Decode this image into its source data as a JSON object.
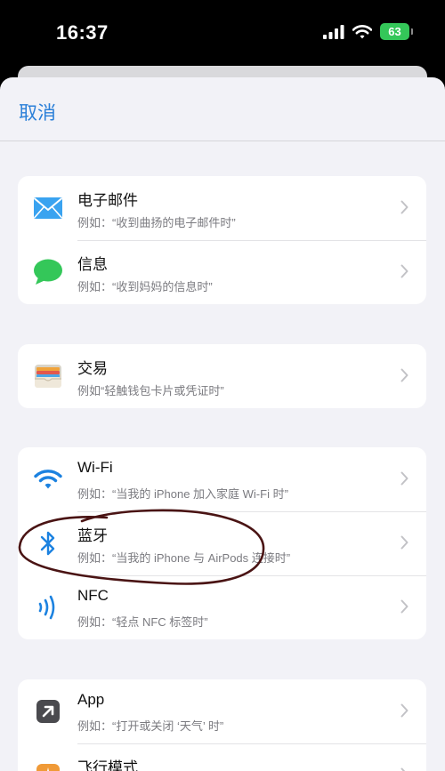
{
  "status_bar": {
    "time": "16:37",
    "battery": "63"
  },
  "nav": {
    "cancel_label": "取消"
  },
  "groups": [
    {
      "items": [
        {
          "title": "电子邮件",
          "subtitle": "例如：“收到曲扬的电子邮件时”",
          "icon": "mail-icon"
        },
        {
          "title": "信息",
          "subtitle": "例如：“收到妈妈的信息时”",
          "icon": "messages-icon"
        }
      ]
    },
    {
      "items": [
        {
          "title": "交易",
          "subtitle": "例如“轻触钱包卡片或凭证时”",
          "icon": "wallet-icon"
        }
      ]
    },
    {
      "items": [
        {
          "title": "Wi-Fi",
          "subtitle": "例如：“当我的 iPhone 加入家庭 Wi-Fi 时”",
          "icon": "wifi-icon"
        },
        {
          "title": "蓝牙",
          "subtitle": "例如：“当我的 iPhone 与 AirPods 连接时”",
          "icon": "bluetooth-icon"
        },
        {
          "title": "NFC",
          "subtitle": "例如：“轻点 NFC 标签时”",
          "icon": "nfc-icon"
        }
      ]
    },
    {
      "items": [
        {
          "title": "App",
          "subtitle": "例如：“打开或关闭 ‘天气’ 时”",
          "icon": "app-icon"
        },
        {
          "title": "飞行模式",
          "subtitle": "",
          "icon": "airplane-icon"
        }
      ]
    }
  ],
  "colors": {
    "accent": "#2a7fd8",
    "battery": "#34c759",
    "messages": "#34c759",
    "scribble": "#4a1414"
  }
}
